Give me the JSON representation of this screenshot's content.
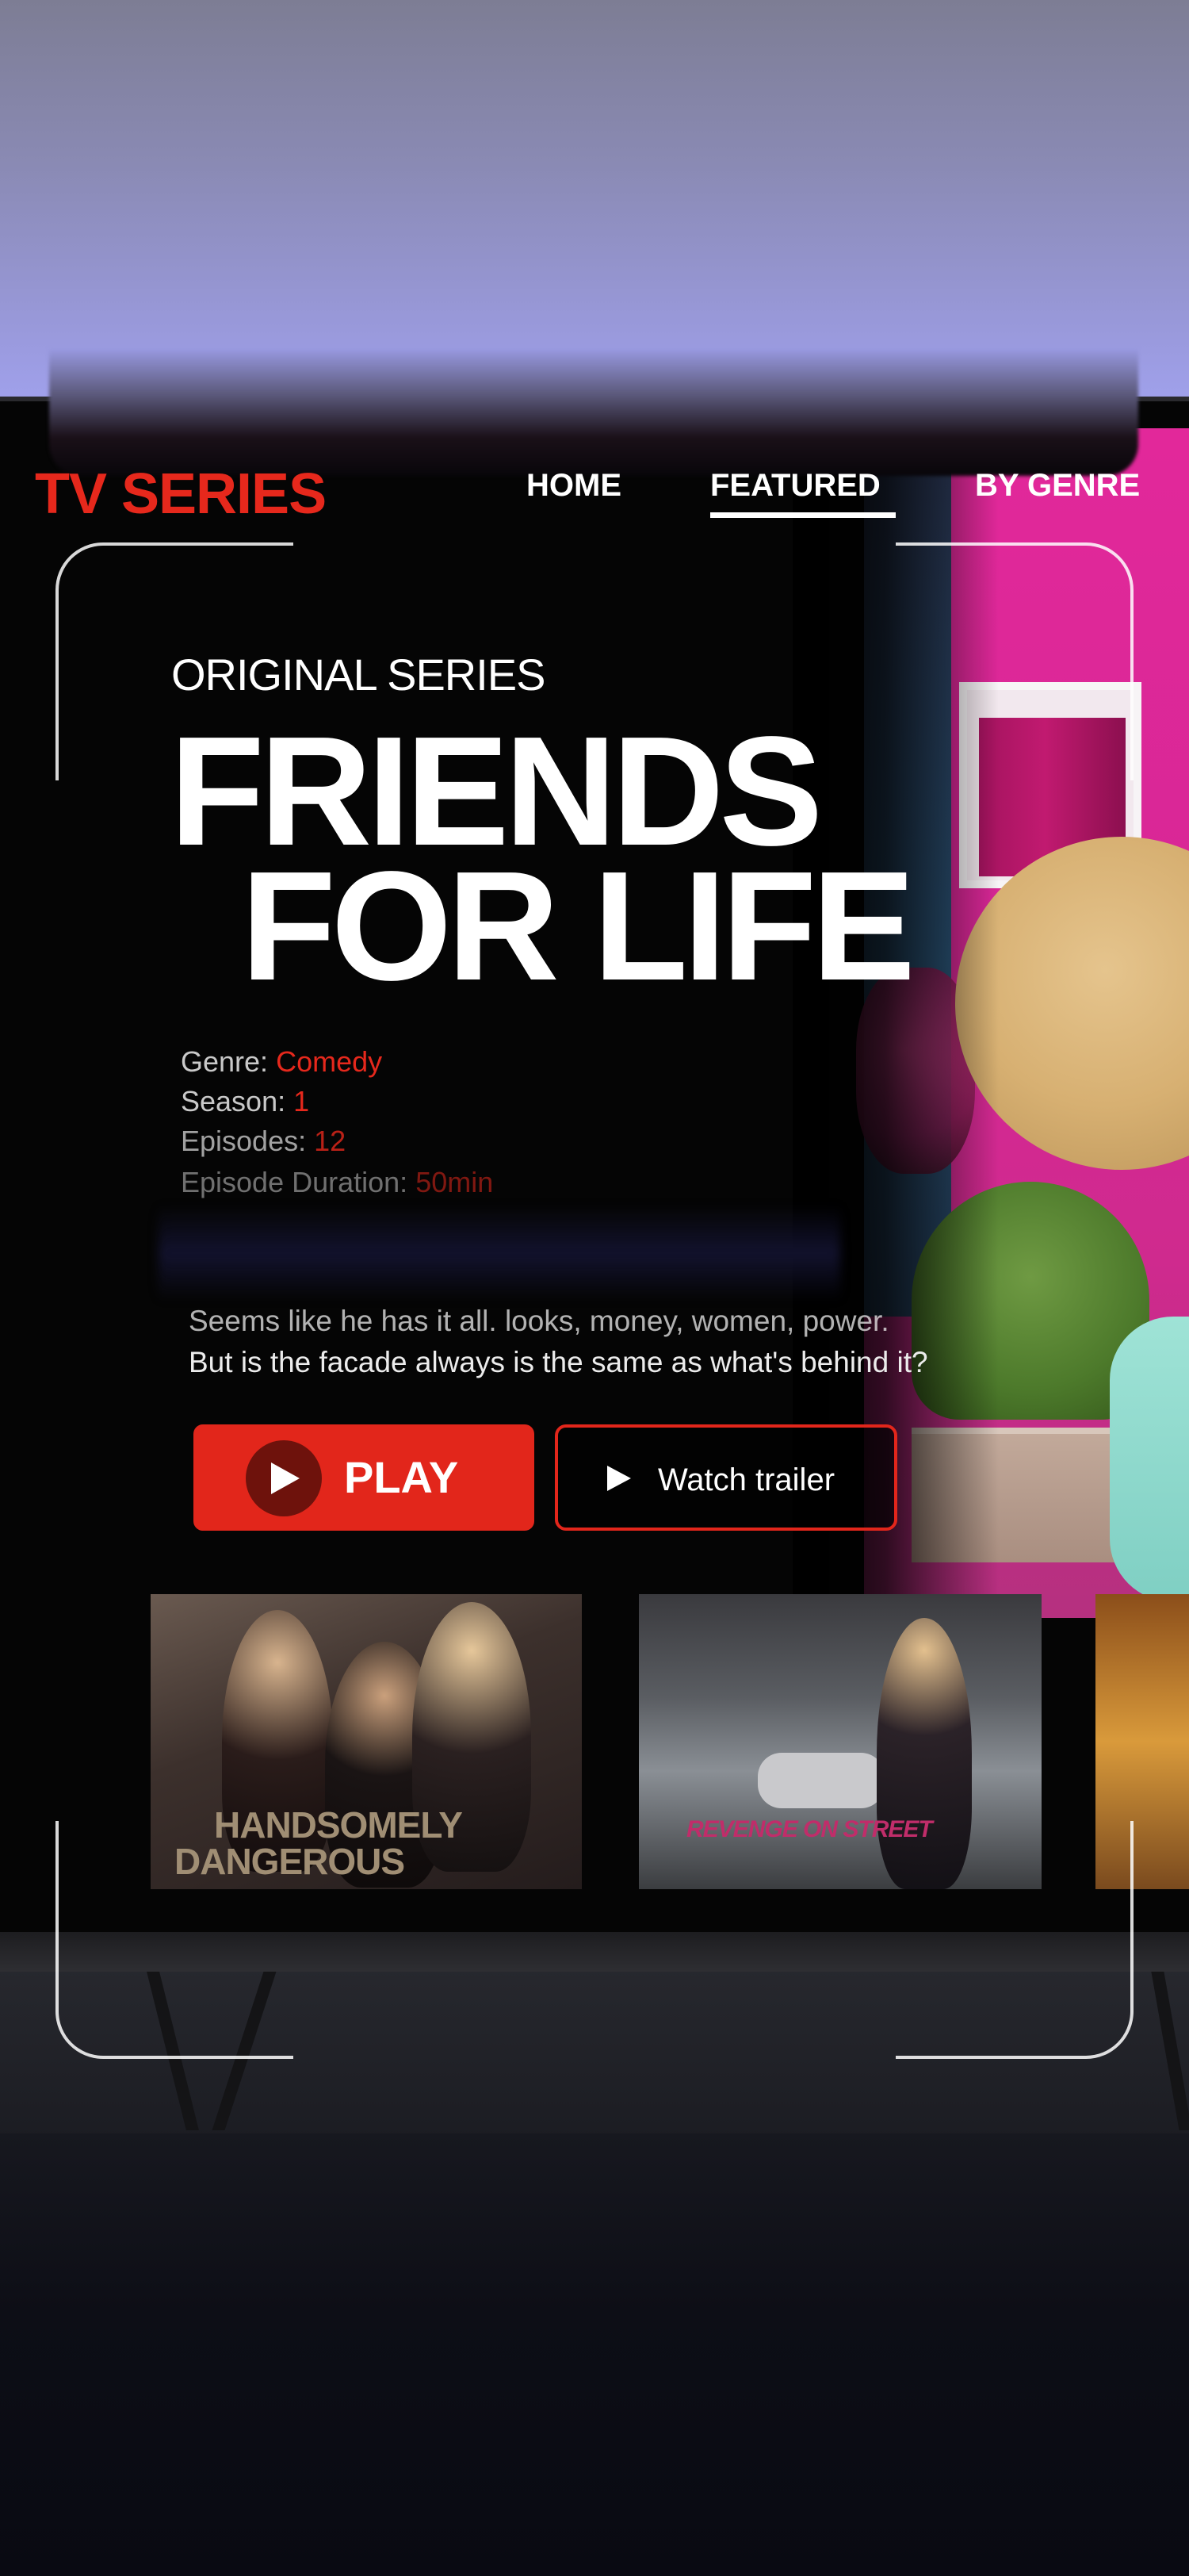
{
  "nav": {
    "brand": "TV SERIES",
    "items": [
      {
        "label": "HOME",
        "active": false
      },
      {
        "label": "FEATURED",
        "active": true
      },
      {
        "label": "BY GENRE",
        "active": false
      }
    ]
  },
  "hero": {
    "eyebrow": "ORIGINAL SERIES",
    "title_line1": "FRIENDS",
    "title_line2": "FOR LIFE",
    "meta": [
      {
        "label": "Genre:",
        "value": "Comedy"
      },
      {
        "label": "Season:",
        "value": "1"
      },
      {
        "label": "Episodes:",
        "value": "12"
      },
      {
        "label": "Episode Duration:",
        "value": "50min"
      }
    ],
    "description_line1": "Seems like he has it all. looks, money, women, power.",
    "description_line2": "But is the facade always is the same as what's behind it?"
  },
  "buttons": {
    "play_label": "PLAY",
    "trailer_label": "Watch trailer"
  },
  "thumbnails": [
    {
      "title_line1": "HANDSOMELY",
      "title_line2": "DANGEROUS"
    },
    {
      "title": "REVENGE ON STREET"
    },
    {
      "title": ""
    }
  ],
  "colors": {
    "accent": "#e2261b",
    "background": "#050505",
    "text": "#ffffff"
  },
  "icons": {
    "play": "play-triangle-icon",
    "trailer": "play-triangle-icon"
  }
}
